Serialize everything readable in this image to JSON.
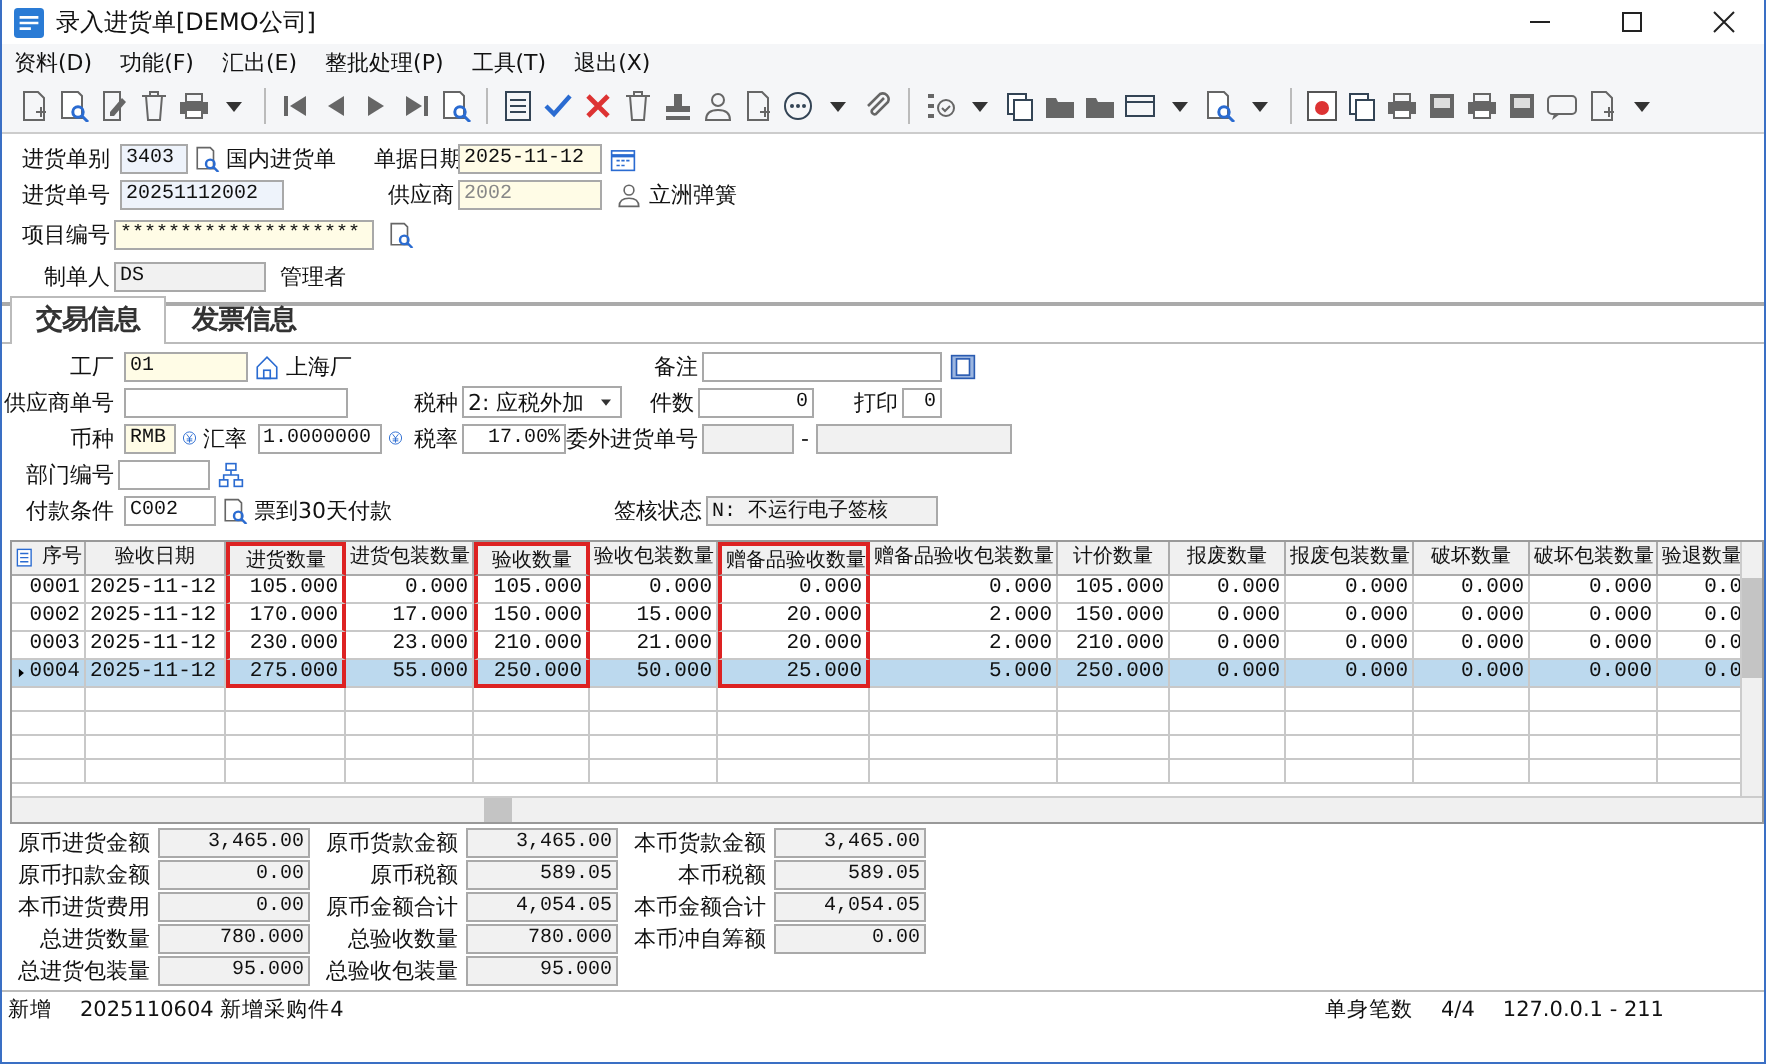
{
  "window": {
    "title": "录入进货单[DEMO公司]"
  },
  "menu": [
    "资料(D)",
    "功能(F)",
    "汇出(E)",
    "整批处理(P)",
    "工具(T)",
    "退出(X)"
  ],
  "header": {
    "order_type": {
      "label": "进货单别",
      "value": "3403",
      "name": "国内进货单"
    },
    "date": {
      "label": "单据日期",
      "value": "2025-11-12"
    },
    "order_no": {
      "label": "进货单号",
      "value": "20251112002"
    },
    "supplier": {
      "label": "供应商",
      "value": "2002",
      "name": "立洲弹簧"
    },
    "project": {
      "label": "项目编号",
      "value": "********************"
    },
    "creator": {
      "label": "制单人",
      "value": "DS",
      "name": "管理者"
    }
  },
  "tabs": [
    {
      "label": "交易信息",
      "selected": true
    },
    {
      "label": "发票信息",
      "selected": false
    }
  ],
  "trade": {
    "factory": {
      "label": "工厂",
      "value": "01",
      "name": "上海厂"
    },
    "note": {
      "label": "备注"
    },
    "supplier_no": {
      "label": "供应商单号"
    },
    "tax_type": {
      "label": "税种",
      "value": "2: 应税外加"
    },
    "pieces": {
      "label": "件数",
      "value": "0"
    },
    "print": {
      "label": "打印",
      "value": "0"
    },
    "currency": {
      "label": "币种",
      "value": "RMB"
    },
    "rate": {
      "label": "汇率",
      "value": "1.0000000"
    },
    "tax_rate": {
      "label": "税率",
      "value": "17.00%"
    },
    "outsource": {
      "label": "委外进货单号",
      "separator": "-"
    },
    "dept": {
      "label": "部门编号"
    },
    "payment": {
      "label": "付款条件",
      "value": "C002",
      "name": "票到30天付款"
    },
    "sign": {
      "label": "签核状态",
      "value": "N: 不运行电子签核"
    }
  },
  "grid": {
    "columns": [
      {
        "label": "序号",
        "highlighted": false
      },
      {
        "label": "验收日期",
        "highlighted": false
      },
      {
        "label": "进货数量",
        "highlighted": true
      },
      {
        "label": "进货包装数量",
        "highlighted": false
      },
      {
        "label": "验收数量",
        "highlighted": true
      },
      {
        "label": "验收包装数量",
        "highlighted": false
      },
      {
        "label": "赠备品验收数量",
        "highlighted": true
      },
      {
        "label": "赠备品验收包装数量",
        "highlighted": false
      },
      {
        "label": "计价数量",
        "highlighted": false
      },
      {
        "label": "报废数量",
        "highlighted": false
      },
      {
        "label": "报废包装数量",
        "highlighted": false
      },
      {
        "label": "破坏数量",
        "highlighted": false
      },
      {
        "label": "破坏包装数量",
        "highlighted": false
      },
      {
        "label": "验退数量",
        "highlighted": false
      }
    ],
    "rows": [
      {
        "selected": false,
        "cells": [
          "0001",
          "2025-11-12",
          "105.000",
          "0.000",
          "105.000",
          "0.000",
          "0.000",
          "0.000",
          "105.000",
          "0.000",
          "0.000",
          "0.000",
          "0.000",
          "0.0"
        ]
      },
      {
        "selected": false,
        "cells": [
          "0002",
          "2025-11-12",
          "170.000",
          "17.000",
          "150.000",
          "15.000",
          "20.000",
          "2.000",
          "150.000",
          "0.000",
          "0.000",
          "0.000",
          "0.000",
          "0.0"
        ]
      },
      {
        "selected": false,
        "cells": [
          "0003",
          "2025-11-12",
          "230.000",
          "23.000",
          "210.000",
          "21.000",
          "20.000",
          "2.000",
          "210.000",
          "0.000",
          "0.000",
          "0.000",
          "0.000",
          "0.0"
        ]
      },
      {
        "selected": true,
        "cells": [
          "0004",
          "2025-11-12",
          "275.000",
          "55.000",
          "250.000",
          "50.000",
          "25.000",
          "5.000",
          "250.000",
          "0.000",
          "0.000",
          "0.000",
          "0.000",
          "0.0"
        ]
      }
    ]
  },
  "totals": [
    {
      "label": "原币进货金额",
      "value": "3,465.00"
    },
    {
      "label": "原币货款金额",
      "value": "3,465.00"
    },
    {
      "label": "本币货款金额",
      "value": "3,465.00"
    },
    {
      "label": "原币扣款金额",
      "value": "0.00"
    },
    {
      "label": "原币税额",
      "value": "589.05"
    },
    {
      "label": "本币税额",
      "value": "589.05"
    },
    {
      "label": "本币进货费用",
      "value": "0.00"
    },
    {
      "label": "原币金额合计",
      "value": "4,054.05"
    },
    {
      "label": "本币金额合计",
      "value": "4,054.05"
    },
    {
      "label": "总进货数量",
      "value": "780.000"
    },
    {
      "label": "总验收数量",
      "value": "780.000"
    },
    {
      "label": "本币冲自筹额",
      "value": "0.00"
    },
    {
      "label": "总进货包装量",
      "value": "95.000"
    },
    {
      "label": "总验收包装量",
      "value": "95.000"
    }
  ],
  "status_bar": {
    "mode": "新增",
    "message": "2025110604 新增采购件4",
    "count_label": "单身笔数",
    "count": "4/4",
    "server": "127.0.0.1 - 211"
  }
}
